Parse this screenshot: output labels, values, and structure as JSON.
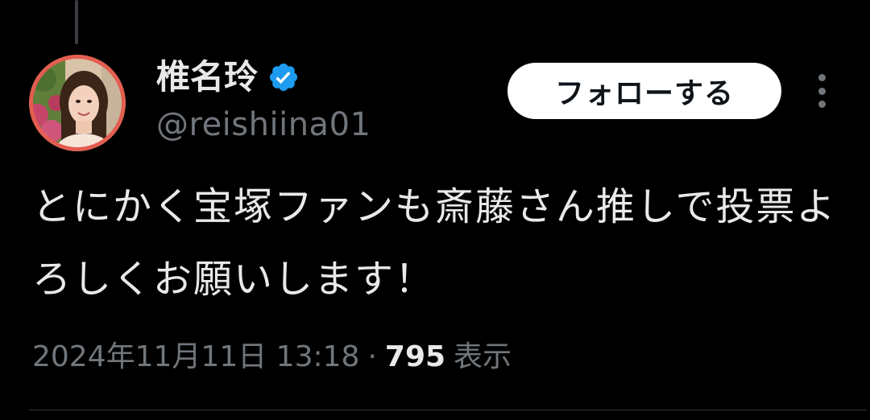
{
  "author": {
    "display_name": "椎名玲",
    "handle": "@reishiina01",
    "verified": true,
    "avatar": "profile-photo-woman"
  },
  "actions": {
    "follow_label": "フォローする",
    "more_icon": "more-vertical-icon"
  },
  "tweet": {
    "text": "とにかく宝塚ファンも斎藤さん推しで投票よろしくお願いします！",
    "date": "2024年11月11日 13:18",
    "separator": "·",
    "views": "795",
    "views_label": "表示"
  },
  "colors": {
    "background": "#000000",
    "primary_text": "#e7e9ea",
    "secondary_text": "#71767b",
    "verified_badge": "#1d9bf0",
    "follow_button_bg": "#ffffff",
    "avatar_ring": "#e35d50"
  }
}
